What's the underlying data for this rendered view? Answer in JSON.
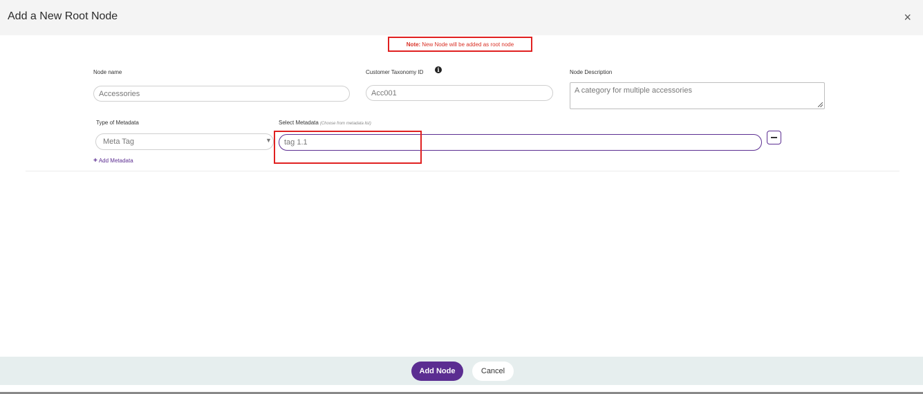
{
  "dialog": {
    "title": "Add a New Root Node",
    "close_glyph": "×"
  },
  "note": {
    "prefix": "Note:",
    "text": "New Node will be added as root node"
  },
  "fields": {
    "node_name": {
      "label": "Node name",
      "value": "Accessories"
    },
    "customer_taxonomy_id": {
      "label": "Customer Taxonomy ID",
      "value": "Acc001",
      "info_glyph": "i"
    },
    "node_description": {
      "label": "Node Description",
      "value": "A category for multiple accessories"
    }
  },
  "metadata": {
    "type_label": "Type of Metadata",
    "type_value": "Meta Tag",
    "select_label": "Select Metadata",
    "select_hint": "(Choose from metadata list)",
    "select_value": "tag 1.1",
    "add_label": "Add Metadata",
    "add_glyph": "+"
  },
  "footer": {
    "add_button": "Add Node",
    "cancel_button": "Cancel"
  },
  "colors": {
    "accent": "#5b2d91",
    "highlight": "#e02020"
  }
}
